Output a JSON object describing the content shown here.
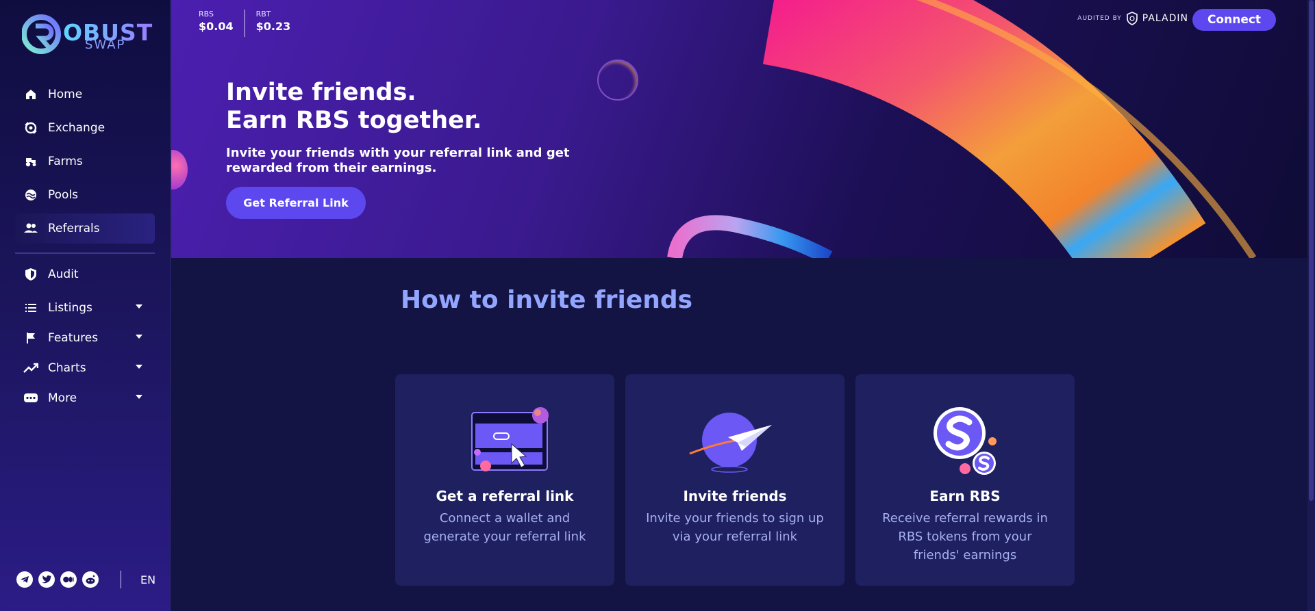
{
  "brand": {
    "word1": "OBUST",
    "word2": "SWAP"
  },
  "sidebar": {
    "items": [
      {
        "label": "Home",
        "icon": "home-icon"
      },
      {
        "label": "Exchange",
        "icon": "exchange-icon"
      },
      {
        "label": "Farms",
        "icon": "tractor-icon"
      },
      {
        "label": "Pools",
        "icon": "pools-icon"
      },
      {
        "label": "Referrals",
        "icon": "people-icon",
        "active": true
      },
      {
        "label": "Audit",
        "icon": "shield-icon"
      },
      {
        "label": "Listings",
        "icon": "list-icon"
      },
      {
        "label": "Features",
        "icon": "flag-icon"
      },
      {
        "label": "Charts",
        "icon": "trending-up-icon"
      },
      {
        "label": "More",
        "icon": "chat-bubble-icon"
      }
    ],
    "language": "EN",
    "socials": [
      "telegram-icon",
      "twitter-icon",
      "medium-icon",
      "reddit-icon"
    ]
  },
  "prices": {
    "rbs_label": "RBS",
    "rbs_value": "$0.04",
    "rbt_label": "RBT",
    "rbt_value": "$0.23"
  },
  "header": {
    "audited_by": "AUDITED BY",
    "auditor": "PALADIN",
    "connect_label": "Connect"
  },
  "hero": {
    "title_line1": "Invite friends.",
    "title_line2": "Earn RBS together.",
    "subtitle": "Invite your friends with your referral link and get rewarded from their earnings.",
    "cta_label": "Get Referral Link"
  },
  "howto": {
    "title": "How to invite friends",
    "cards": [
      {
        "title": "Get a referral link",
        "text": "Connect a wallet and generate your referral link"
      },
      {
        "title": "Invite friends",
        "text": "Invite your friends to sign up via your referral link"
      },
      {
        "title": "Earn RBS",
        "text": "Receive referral rewards in RBS tokens from your friends' earnings"
      }
    ]
  },
  "colors": {
    "accent": "#5d48f0",
    "title_blue": "#93a6ff",
    "card_bg": "#1e2060"
  }
}
